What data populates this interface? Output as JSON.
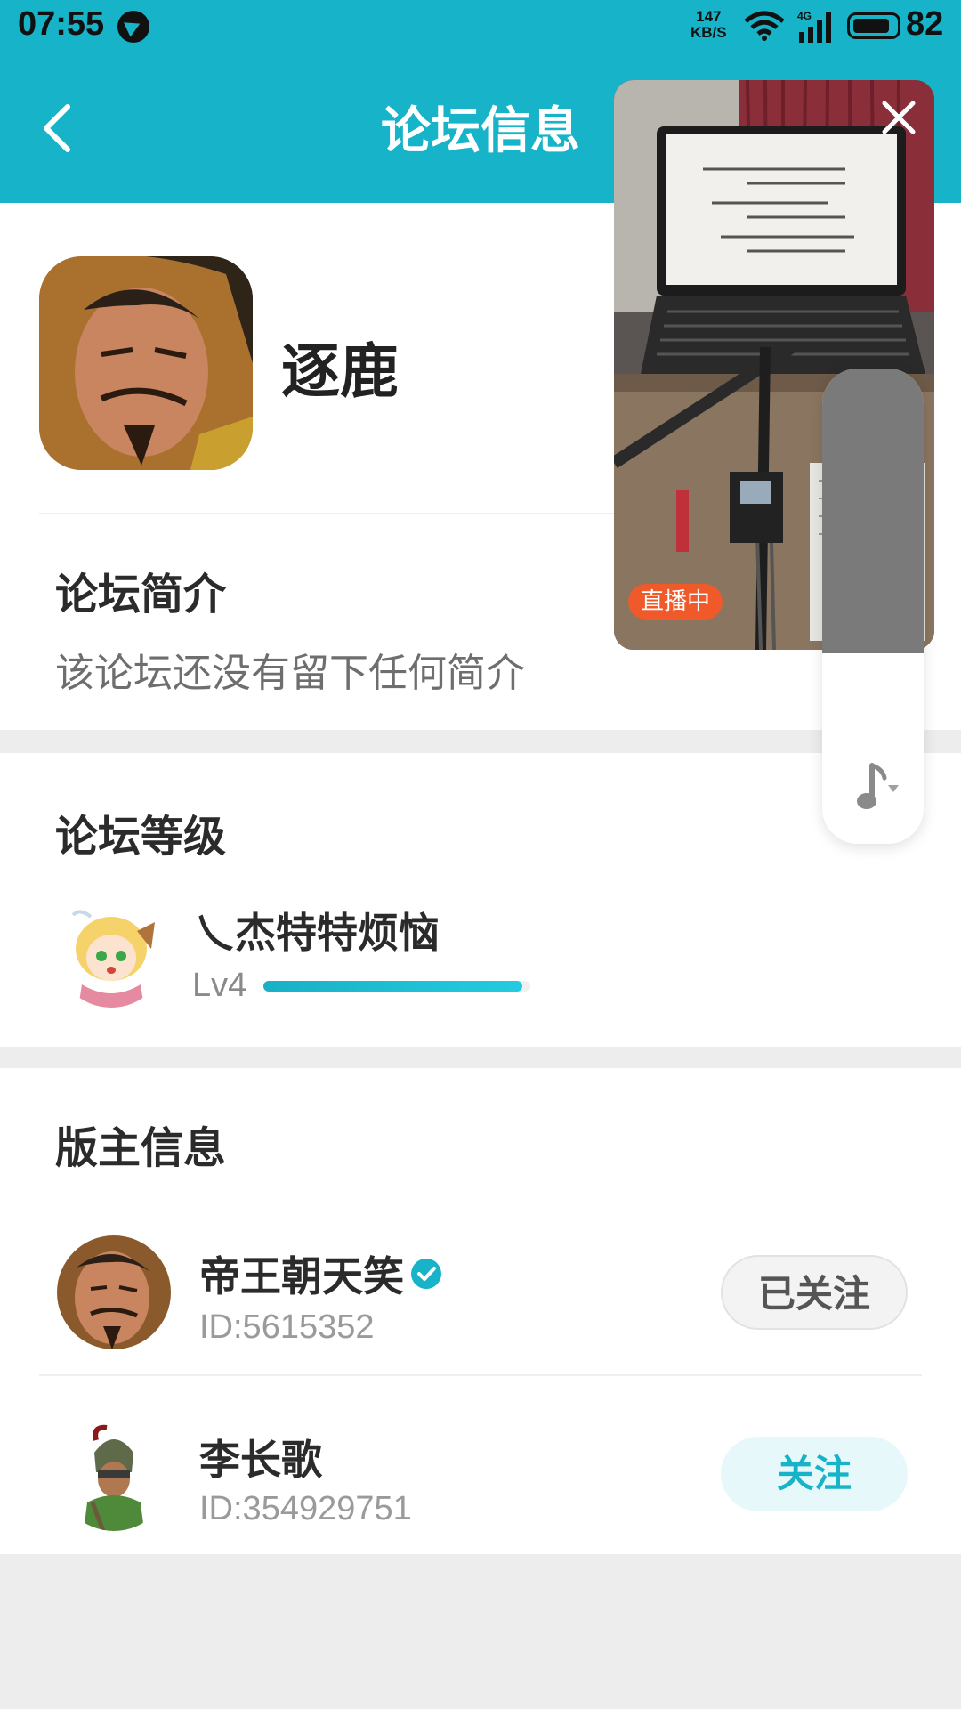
{
  "status_bar": {
    "time": "07:55",
    "speed_value": "147",
    "speed_unit": "KB/S",
    "network": "4G",
    "battery": "82"
  },
  "header": {
    "title": "论坛信息"
  },
  "forum": {
    "name": "逐鹿"
  },
  "intro": {
    "title": "论坛简介",
    "text": "该论坛还没有留下任何简介"
  },
  "level": {
    "title": "论坛等级",
    "user_name": "乀杰特特烦恼",
    "lv": "Lv4",
    "progress_fraction": 0.97
  },
  "moderators": {
    "title": "版主信息",
    "items": [
      {
        "name": "帝王朝天笑",
        "id": "ID:5615352",
        "verified": true,
        "button": "已关注"
      },
      {
        "name": "李长歌",
        "id": "ID:354929751",
        "verified": false,
        "button": "关注"
      }
    ]
  },
  "pip": {
    "live_label": "直播中"
  },
  "colors": {
    "accent": "#17b3c8",
    "live": "#f05a2a"
  },
  "icons": {
    "back": "chevron-left-icon",
    "close": "close-icon",
    "verified": "verified-badge-icon",
    "music": "music-note-icon"
  }
}
